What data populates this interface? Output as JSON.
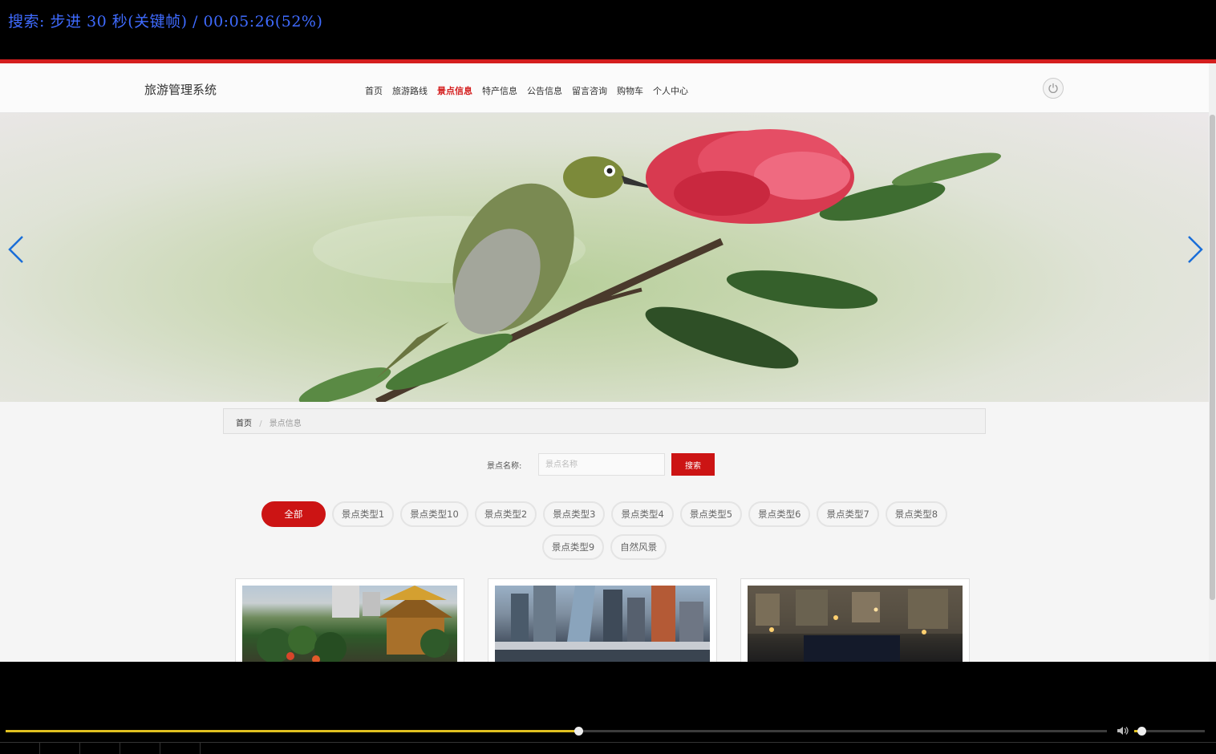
{
  "osd": {
    "text": "搜索: 步进 30 秒(关键帧) / 00:05:26(52%)"
  },
  "header": {
    "site_title": "旅游管理系统",
    "nav": [
      "首页",
      "旅游路线",
      "景点信息",
      "特产信息",
      "公告信息",
      "留言咨询",
      "购物车",
      "个人中心"
    ],
    "active_nav": "景点信息"
  },
  "breadcrumb": {
    "home": "首页",
    "separator": "/",
    "current": "景点信息"
  },
  "search": {
    "label": "景点名称:",
    "placeholder": "景点名称",
    "button": "搜索"
  },
  "categories": {
    "row1": [
      "全部",
      "景点类型1",
      "景点类型10",
      "景点类型2",
      "景点类型3",
      "景点类型4",
      "景点类型5",
      "景点类型6",
      "景点类型7",
      "景点类型8"
    ],
    "row2": [
      "景点类型9",
      "自然风景"
    ],
    "active": "全部"
  },
  "player": {
    "progress_percent": 52,
    "volume_percent": 10
  },
  "colors": {
    "accent": "#cc1414",
    "osd": "#3f6bff",
    "progress": "#e0c020"
  }
}
